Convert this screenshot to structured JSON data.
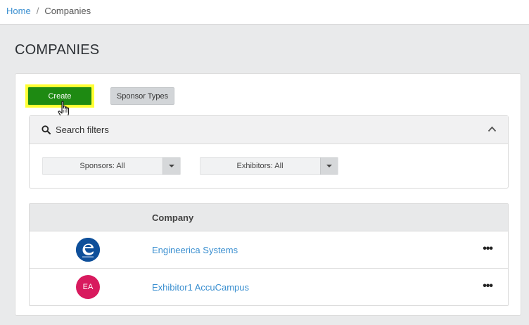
{
  "breadcrumb": {
    "home": "Home",
    "separator": "/",
    "current": "Companies"
  },
  "page": {
    "title": "COMPANIES"
  },
  "toolbar": {
    "create_label": "Create",
    "sponsor_types_label": "Sponsor Types"
  },
  "filters": {
    "title": "Search filters",
    "sponsors_value": "Sponsors: All",
    "exhibitors_value": "Exhibitors: All"
  },
  "table": {
    "columns": [
      "",
      "Company"
    ],
    "rows": [
      {
        "avatar_text": "",
        "avatar_icon": "engineerica-logo-icon",
        "name": "Engineerica Systems"
      },
      {
        "avatar_text": "EA",
        "name": "Exhibitor1 AccuCampus"
      }
    ],
    "more_label": "•••"
  },
  "colors": {
    "accent_green": "#1e8a12",
    "highlight_yellow": "#ffff33",
    "link_blue": "#3a8fd0",
    "avatar_blue": "#0e4f9a",
    "avatar_pink": "#d81a5e"
  }
}
